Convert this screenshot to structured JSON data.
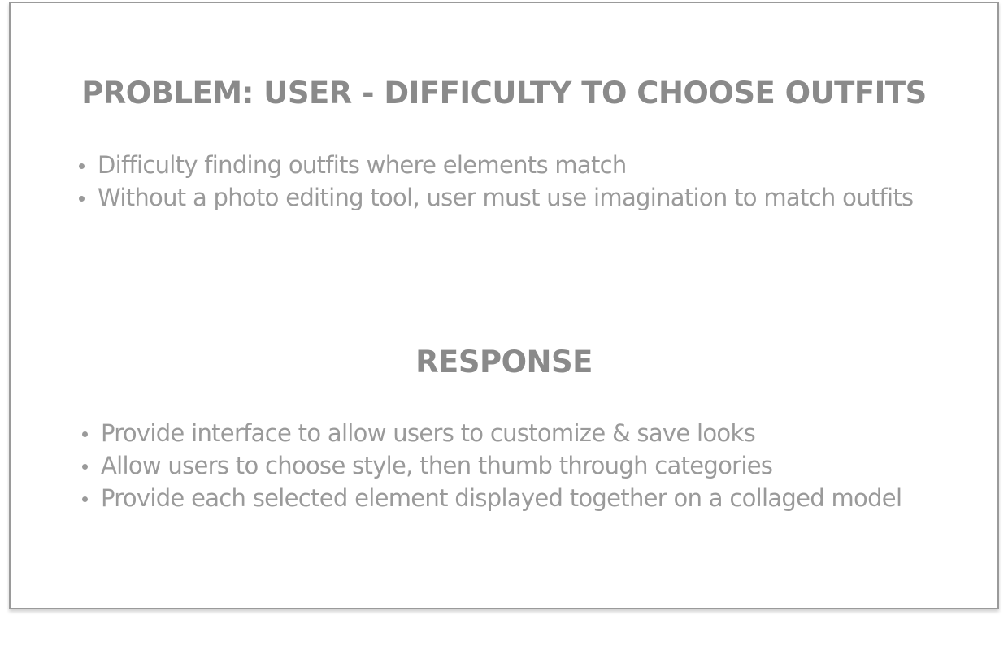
{
  "problem": {
    "title": "PROBLEM: USER - DIFFICULTY TO CHOOSE OUTFITS",
    "bullets": [
      "Difficulty finding outfits where elements match",
      "Without a photo editing tool, user must use imagination to match outfits"
    ]
  },
  "response": {
    "title": "RESPONSE",
    "bullets": [
      "Provide interface to allow users to customize & save looks",
      "Allow users to choose style, then thumb through categories",
      "Provide each selected element displayed together on a collaged model"
    ]
  }
}
